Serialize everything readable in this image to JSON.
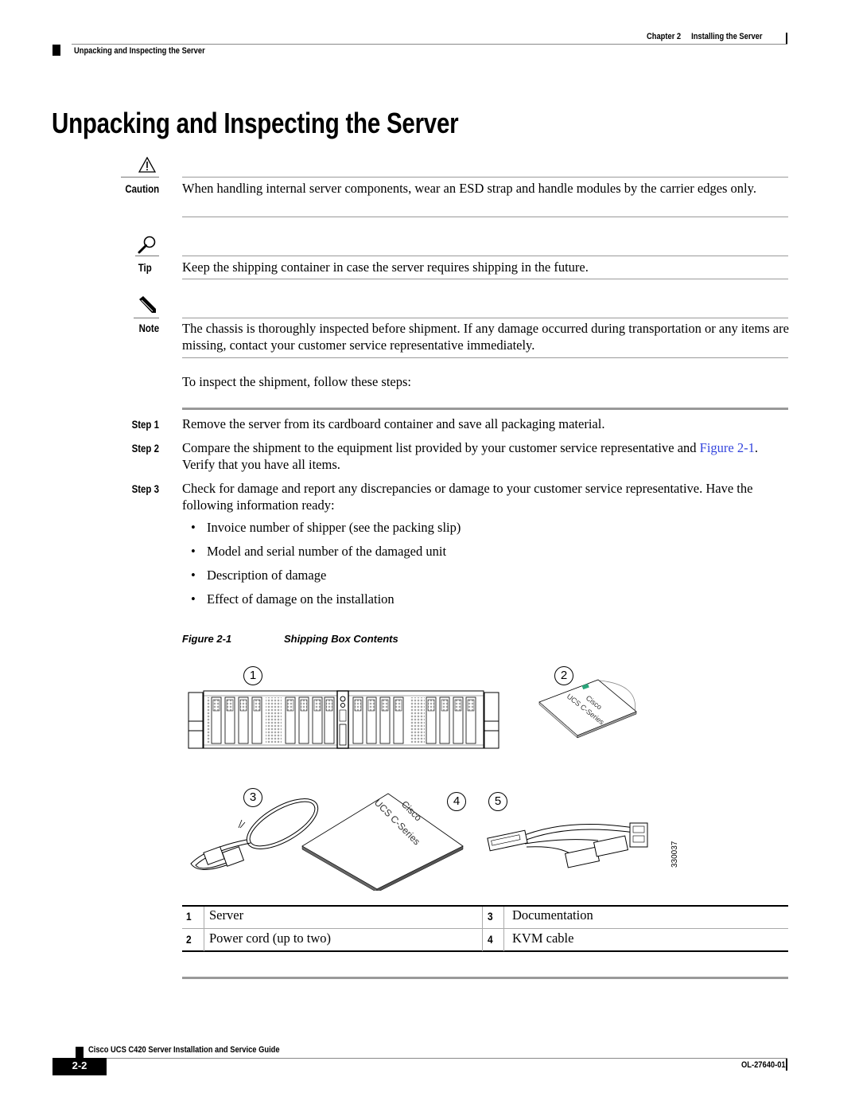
{
  "header": {
    "chapter": "Chapter 2",
    "chapter_title": "Installing the Server",
    "section": "Unpacking and Inspecting the Server"
  },
  "page_title": "Unpacking and Inspecting the Server",
  "caution": {
    "label": "Caution",
    "icon": "warning-triangle-icon",
    "text": "When handling internal server components, wear an ESD strap and handle modules by the carrier edges only."
  },
  "tip": {
    "label": "Tip",
    "icon": "magnifier-icon",
    "text": "Keep the shipping container in case the server requires shipping in the future."
  },
  "note": {
    "label": "Note",
    "icon": "pencil-icon",
    "text": "The chassis is thoroughly inspected before shipment. If any damage occurred during transportation or any items are missing, contact your customer service representative immediately."
  },
  "intro": "To inspect the shipment, follow these steps:",
  "steps": [
    {
      "label": "Step 1",
      "text": "Remove the server from its cardboard container and save all packaging material."
    },
    {
      "label": "Step 2",
      "text_before": "Compare the shipment to the equipment list provided by your customer service representative and ",
      "link": "Figure 2-1",
      "text_after": ". Verify that you have all items."
    },
    {
      "label": "Step 3",
      "text": "Check for damage and report any discrepancies or damage to your customer service representative. Have the following information ready:"
    }
  ],
  "bullets": [
    "Invoice number of shipper (see the packing slip)",
    "Model and serial number of the damaged unit",
    "Description of damage",
    "Effect of damage on the installation"
  ],
  "figure": {
    "number": "Figure 2-1",
    "title": "Shipping Box Contents",
    "callouts": [
      "1",
      "2",
      "3",
      "4",
      "5"
    ],
    "cd_text_line1": "Cisco",
    "cd_text_line2": "UCS C-Series",
    "doc_text_line1": "Cisco",
    "doc_text_line2": "UCS C-Series",
    "art_id": "330037"
  },
  "legend": [
    {
      "num": "1",
      "text": "Server"
    },
    {
      "num": "2",
      "text": "Power cord (up to two)"
    },
    {
      "num": "3",
      "text": "Documentation"
    },
    {
      "num": "4",
      "text": "KVM cable"
    }
  ],
  "footer": {
    "guide_title": "Cisco UCS C420 Server Installation and Service Guide",
    "page_number": "2-2",
    "doc_id": "OL-27640-01"
  }
}
